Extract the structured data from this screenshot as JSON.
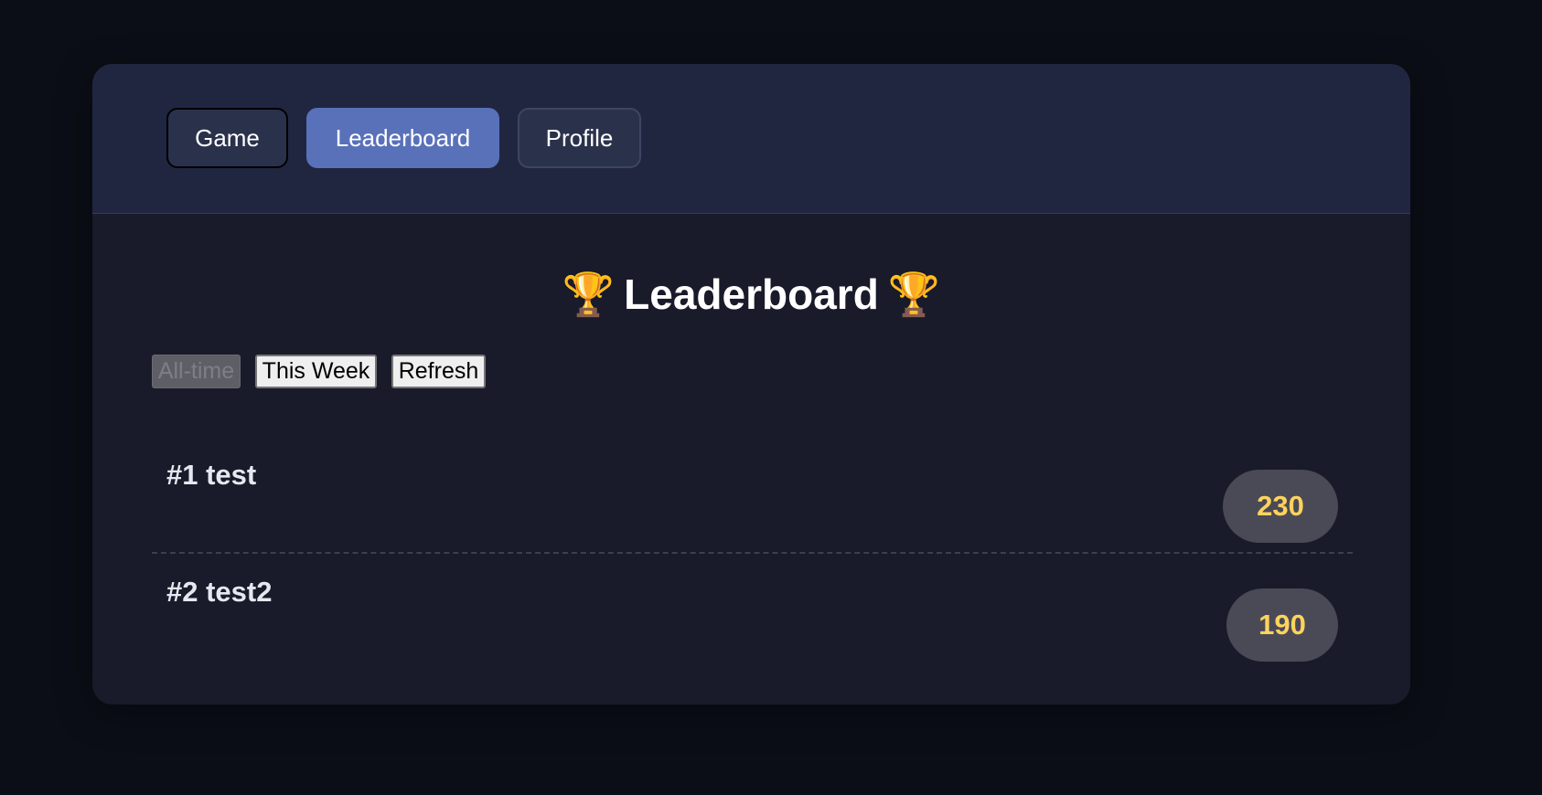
{
  "nav": {
    "tabs": [
      {
        "label": "Game"
      },
      {
        "label": "Leaderboard"
      },
      {
        "label": "Profile"
      }
    ],
    "active_tab": "Leaderboard"
  },
  "leaderboard": {
    "title": "Leaderboard",
    "title_icons": [
      "trophy-icon",
      "trophy-icon"
    ],
    "filters": [
      {
        "label": "All-time",
        "state": "disabled"
      },
      {
        "label": "This Week",
        "state": "enabled"
      },
      {
        "label": "Refresh",
        "state": "enabled"
      }
    ],
    "entries": [
      {
        "label": "#1 test",
        "score": "230"
      },
      {
        "label": "#2 test2",
        "score": "190"
      }
    ]
  },
  "colors": {
    "background": "#0b0e16",
    "card": "#191b2b",
    "header": "#212640",
    "accent": "#5871b9",
    "score_text": "#ffd35c",
    "score_pill": "#4a4a57"
  }
}
